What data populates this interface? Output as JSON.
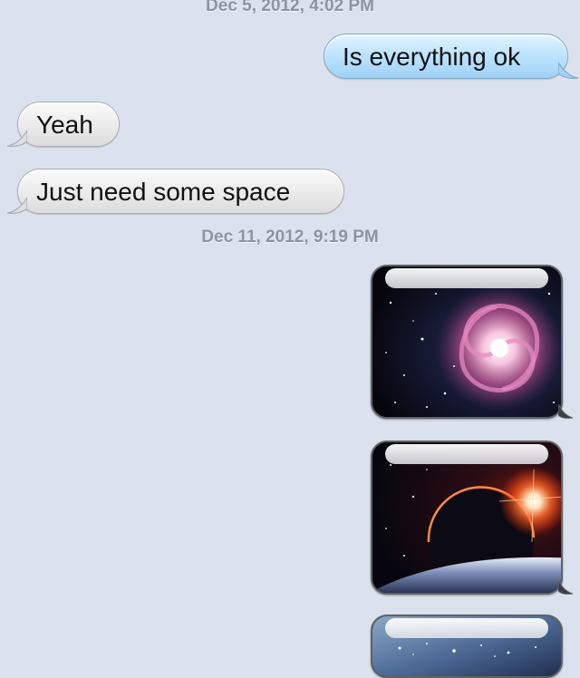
{
  "conversation": {
    "timestamps": [
      "Dec 5, 2012, 4:02 PM",
      "Dec 11, 2012, 9:19 PM"
    ],
    "messages": [
      {
        "direction": "outgoing",
        "text": "Is everything ok"
      },
      {
        "direction": "incoming",
        "text": "Yeah"
      },
      {
        "direction": "incoming",
        "text": "Just need some space"
      }
    ],
    "image_messages": [
      {
        "direction": "outgoing",
        "content": "spiral galaxy"
      },
      {
        "direction": "outgoing",
        "content": "planet with sunrise"
      },
      {
        "direction": "outgoing",
        "content": "star field"
      }
    ]
  },
  "colors": {
    "background": "#dbe2ed",
    "outgoing_bubble": "#bfe4fd",
    "incoming_bubble": "#ececec",
    "timestamp_text": "#8c94a3"
  }
}
